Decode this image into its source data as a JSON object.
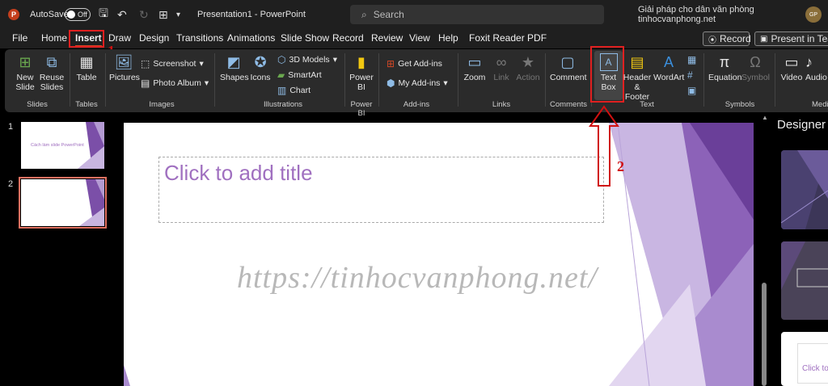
{
  "titlebar": {
    "autosave_label": "AutoSave",
    "autosave_state": "Off",
    "doc_title": "Presentation1 - PowerPoint",
    "search_placeholder": "Search",
    "tagline": "Giải pháp cho dân văn phòng tinhocvanphong.net",
    "user_initials": "GP"
  },
  "menu": {
    "tabs": [
      "File",
      "Home",
      "Insert",
      "Draw",
      "Design",
      "Transitions",
      "Animations",
      "Slide Show",
      "Record",
      "Review",
      "View",
      "Help",
      "Foxit Reader PDF"
    ],
    "active_tab": "Insert",
    "record_button": "Record",
    "present_button": "Present in Teams"
  },
  "annotations": {
    "step1": "1",
    "step2": "2"
  },
  "ribbon": {
    "new_slide": "New Slide",
    "reuse_slides": "Reuse Slides",
    "table": "Table",
    "pictures": "Pictures",
    "screenshot": "Screenshot",
    "photo_album": "Photo Album",
    "shapes": "Shapes",
    "icons": "Icons",
    "models_3d": "3D Models",
    "smartart": "SmartArt",
    "chart": "Chart",
    "power_bi": "Power BI",
    "get_addins": "Get Add-ins",
    "my_addins": "My Add-ins",
    "zoom": "Zoom",
    "link": "Link",
    "action": "Action",
    "comment": "Comment",
    "text_box": "Text Box",
    "header_footer": "Header & Footer",
    "wordart": "WordArt",
    "equation": "Equation",
    "symbol": "Symbol",
    "video": "Video",
    "audio": "Audio"
  },
  "groups": {
    "slides": "Slides",
    "tables": "Tables",
    "images": "Images",
    "illustrations": "Illustrations",
    "power_bi": "Power BI",
    "addins": "Add-ins",
    "links": "Links",
    "comments": "Comments",
    "text": "Text",
    "symbols": "Symbols",
    "media": "Media"
  },
  "slides_panel": {
    "slide1_num": "1",
    "slide1_title": "Cách làm slide PowerPoint",
    "slide2_num": "2"
  },
  "slide": {
    "title_placeholder": "Click to add title",
    "watermark": "https://tinhocvanphong.net/"
  },
  "designer": {
    "title": "Designer",
    "card3_text": "Click to"
  },
  "colors": {
    "accent": "#d24726",
    "annotation": "#e02020",
    "placeholder": "#a070c0"
  }
}
